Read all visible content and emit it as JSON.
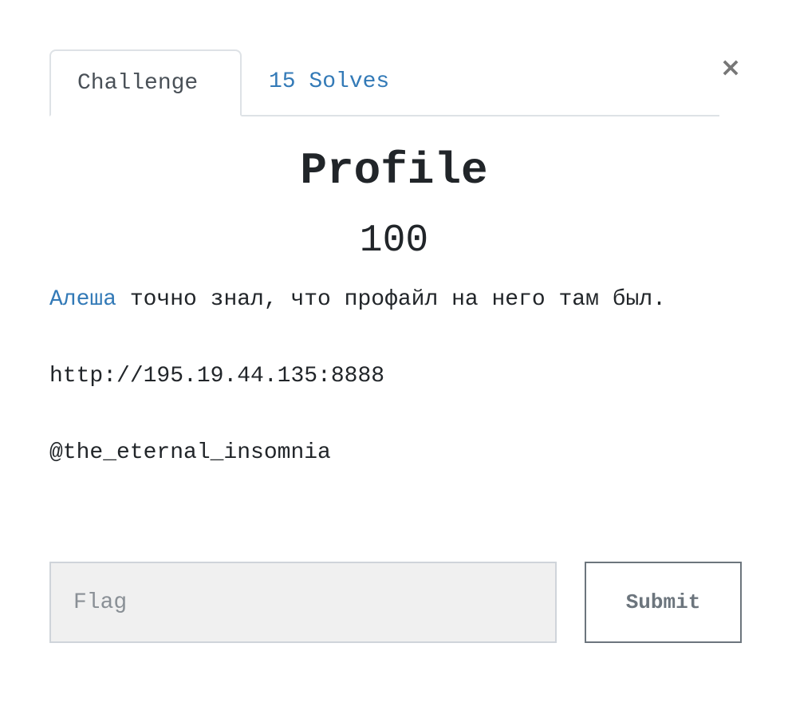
{
  "modal": {
    "close_label": "×"
  },
  "tabs": [
    {
      "label": "Challenge",
      "active": true
    },
    {
      "label": "15 Solves",
      "active": false
    }
  ],
  "challenge": {
    "name": "Profile",
    "value": "100",
    "description": {
      "link_text": "Алеша",
      "text_after_link": " точно знал, что профайл на него там был.",
      "url": "http://195.19.44.135:8888",
      "author": "@the_eternal_insomnia"
    }
  },
  "form": {
    "flag_placeholder": "Flag",
    "flag_value": "",
    "submit_label": "Submit"
  },
  "colors": {
    "link": "#337ab7",
    "text": "#212529",
    "input_bg": "#f0f0f0",
    "button_border": "#6c757d"
  }
}
